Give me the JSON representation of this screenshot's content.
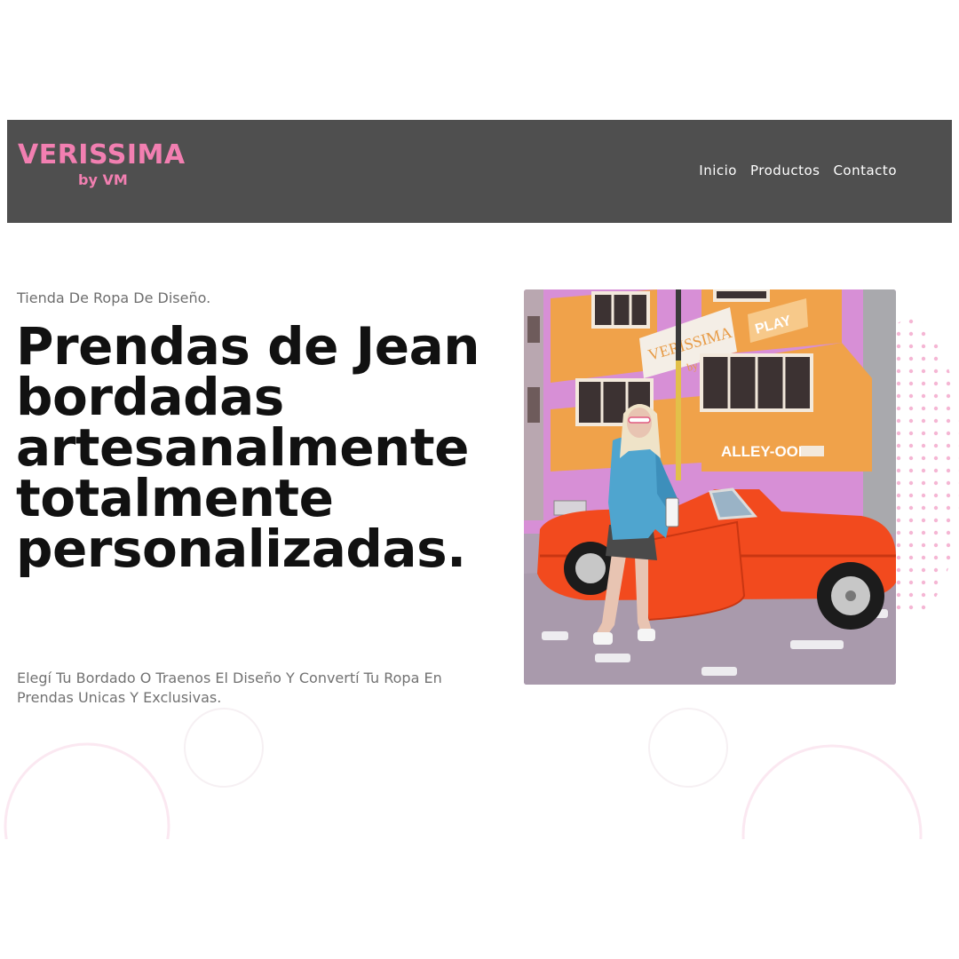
{
  "brand": {
    "name": "VERISSIMA",
    "sub": "by VM",
    "color": "#f27fb1"
  },
  "nav": {
    "items": [
      "Inicio",
      "Productos",
      "Contacto"
    ]
  },
  "hero": {
    "kicker": "Tienda De Ropa De Diseño.",
    "headline": "Prendas de Jean bordadas artesanalmente totalmente personalizadas.",
    "subcopy": "Elegí Tu Bordado O Traenos El Diseño Y Convertí Tu Ropa En Prendas Unicas Y Exclusivas.",
    "image": {
      "mural_brand": "VERISSIMA",
      "mural_sub": "by VM",
      "mural_sign_1": "PLAY",
      "mural_sign_2": "ALLEY-OOP"
    }
  },
  "colors": {
    "header_bg": "#4f4f4f",
    "accent_pink": "#f27fb1",
    "headline": "#111111",
    "body_text": "#727272"
  }
}
